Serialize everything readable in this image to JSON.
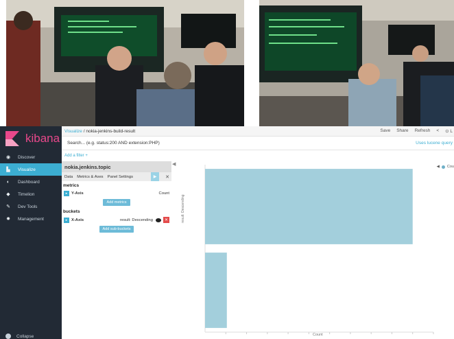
{
  "photos": [
    {
      "id": "left",
      "icon": "photo-meeting-left"
    },
    {
      "id": "right",
      "icon": "photo-meeting-right"
    }
  ],
  "app": {
    "brand": "kibana",
    "brand_color": "#e8488b",
    "accent_color": "#3caed2",
    "nav": [
      {
        "label": "Discover",
        "icon": "compass-icon",
        "glyph": "◉"
      },
      {
        "label": "Visualize",
        "icon": "bar-chart-icon",
        "glyph": "▙"
      },
      {
        "label": "Dashboard",
        "icon": "dashboard-icon",
        "glyph": "◐"
      },
      {
        "label": "Timelion",
        "icon": "timelion-icon",
        "glyph": "◆"
      },
      {
        "label": "Dev Tools",
        "icon": "wrench-icon",
        "glyph": "✎"
      },
      {
        "label": "Management",
        "icon": "gear-icon",
        "glyph": "✹"
      }
    ],
    "collapse_label": "Collapse"
  },
  "topbar": {
    "crumb_link": "Visualize",
    "crumb_sep": "/",
    "crumb_current": "nokia-jenkins-build-result",
    "save": "Save",
    "share": "Share",
    "refresh": "Refresh",
    "prev": "<",
    "time_picker": "⊙ L"
  },
  "search": {
    "placeholder": "Search... (e.g. status:200 AND extension:PHP)",
    "lucene": "Uses lucene query"
  },
  "filter": {
    "add_label": "Add a filter +"
  },
  "editor": {
    "index": "nokia.jenkins.topic",
    "tabs": [
      "Data",
      "Metrics & Axes",
      "Panel Settings"
    ],
    "play": "▶",
    "close": "✕",
    "metrics_title": "metrics",
    "metric_axis": "Y-Axis",
    "metric_value": "Count",
    "add_metrics": "Add metrics",
    "buckets_title": "buckets",
    "bucket_axis": "X-Axis",
    "bucket_value": "result: Descending",
    "add_sub_buckets": "Add sub-buckets",
    "toggle_glyph": "▸",
    "remove_glyph": "✕"
  },
  "viz": {
    "collapse_glyph": "◀",
    "legend_toggle": "◀",
    "legend_label": "Cou",
    "y_axis_label": "result: Descending",
    "x_axis_label": "Count"
  },
  "chart_data": {
    "type": "bar",
    "orientation": "horizontal",
    "categories": [
      "",
      ""
    ],
    "values": [
      100,
      10.5
    ],
    "xlabel": "Count",
    "ylabel": "result: Descending",
    "xlim": [
      0,
      110
    ],
    "bar_color": "#a3cfdc",
    "grid": false,
    "legend": "top-right"
  }
}
